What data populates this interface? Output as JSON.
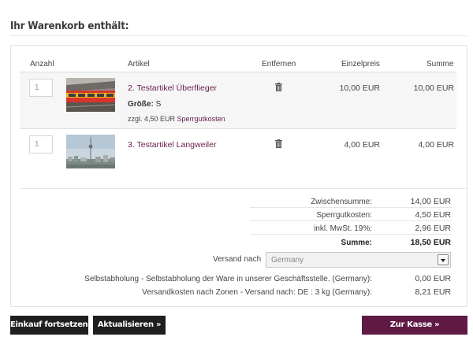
{
  "cart": {
    "heading": "Ihr Warenkorb enthält:",
    "columns": {
      "qty": "Anzahl",
      "article": "Artikel",
      "remove": "Entfernen",
      "unit_price": "Einzelpreis",
      "sum": "Summe"
    },
    "items": [
      {
        "qty": "1",
        "name": "2. Testartikel Überflieger",
        "size_label": "Größe:",
        "size_value": "S",
        "extra_prefix": "zzgl. 4,50 EUR",
        "extra_link": "Sperrgutkosten",
        "unit_price": "10,00 EUR",
        "sum": "10,00 EUR",
        "thumb_icon": "train-photo"
      },
      {
        "qty": "1",
        "name": "3. Testartikel Langweiler",
        "unit_price": "4,00 EUR",
        "sum": "4,00 EUR",
        "thumb_icon": "city-tv-tower-photo"
      }
    ],
    "totals": {
      "subtotal_label": "Zwischensumme:",
      "subtotal_value": "14,00 EUR",
      "bulky_label": "Sperrgutkosten:",
      "bulky_value": "4,50 EUR",
      "vat_label": "inkl. MwSt. 19%:",
      "vat_value": "2,96 EUR",
      "total_label": "Summe:",
      "total_value": "18,50 EUR"
    },
    "shipping": {
      "label": "Versand nach",
      "selected_country": "Germany",
      "options": [
        {
          "label": "Selbstabholung - Selbstabholung der Ware in unserer Geschäftsstelle. (Germany):",
          "value": "0,00 EUR"
        },
        {
          "label": "Versandkosten nach Zonen - Versand nach: DE : 3 kg (Germany):",
          "value": "8,21 EUR"
        }
      ]
    },
    "buttons": {
      "continue": "Einkauf fortsetzen »",
      "update": "Aktualisieren »",
      "checkout": "Zur Kasse »"
    },
    "colors": {
      "accent": "#6b2151",
      "checkout_button": "#5e1a45",
      "dark_button": "#1f1f1f"
    }
  }
}
